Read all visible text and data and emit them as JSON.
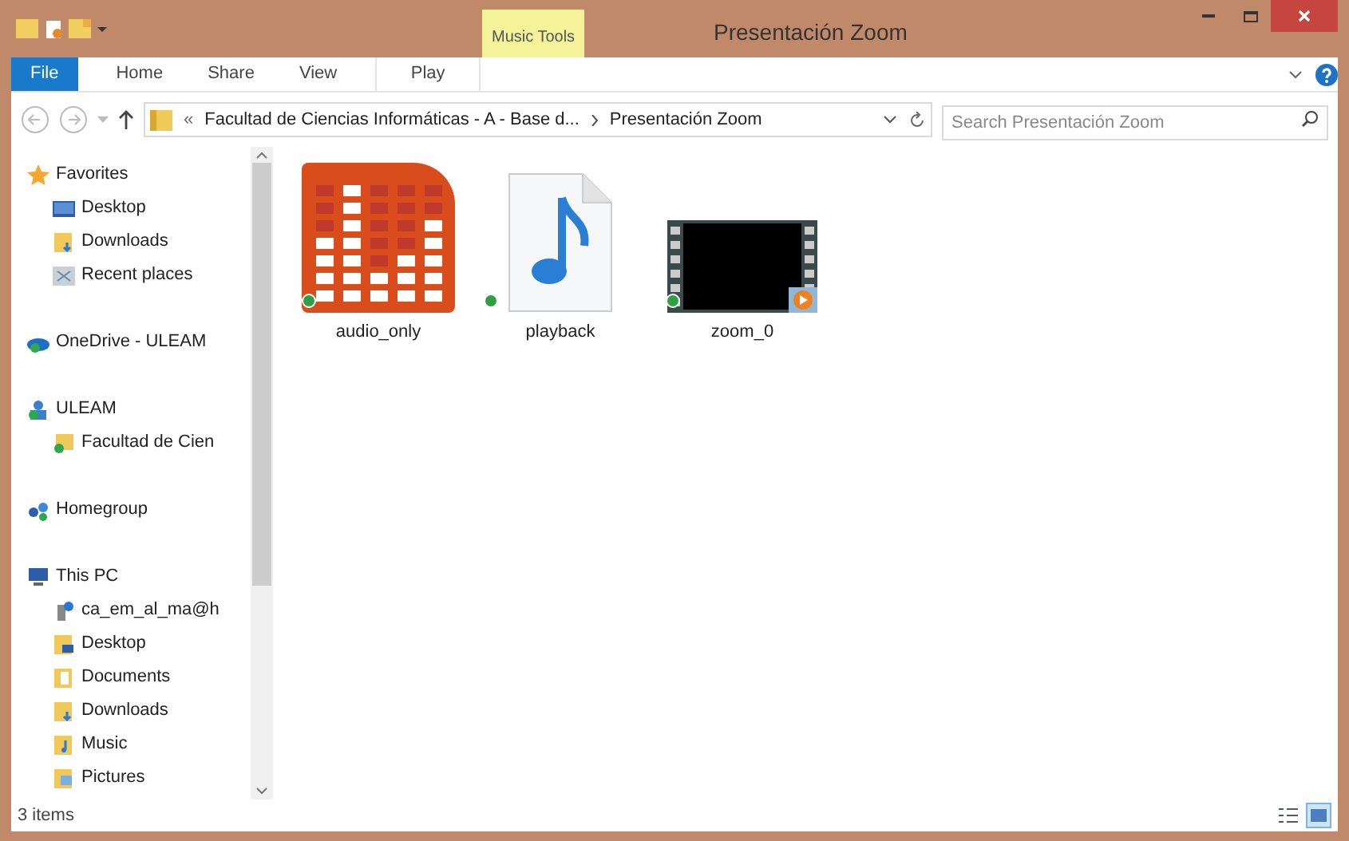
{
  "window": {
    "title": "Presentación Zoom",
    "context_group": "Music Tools"
  },
  "ribbon_tabs": [
    {
      "label": "File",
      "kind": "file",
      "selected": false
    },
    {
      "label": "Home",
      "kind": "tab",
      "selected": false
    },
    {
      "label": "Share",
      "kind": "tab",
      "selected": false
    },
    {
      "label": "View",
      "kind": "tab",
      "selected": false
    },
    {
      "label": "Play",
      "kind": "context",
      "selected": false
    }
  ],
  "address": {
    "overflow": "«",
    "segments": [
      "Facultad de Ciencias Informáticas - A - Base d...",
      "Presentación Zoom"
    ]
  },
  "search": {
    "placeholder": "Search Presentación Zoom"
  },
  "nav_tree": [
    {
      "label": "Favorites",
      "children": [
        {
          "label": "Desktop"
        },
        {
          "label": "Downloads"
        },
        {
          "label": "Recent places"
        }
      ]
    },
    {
      "label": "OneDrive - ULEAM"
    },
    {
      "label": "ULEAM",
      "children": [
        {
          "label": "Facultad de Cien"
        }
      ]
    },
    {
      "label": "Homegroup"
    },
    {
      "label": "This PC",
      "children": [
        {
          "label": "ca_em_al_ma@h"
        },
        {
          "label": "Desktop"
        },
        {
          "label": "Documents"
        },
        {
          "label": "Downloads"
        },
        {
          "label": "Music"
        },
        {
          "label": "Pictures"
        }
      ]
    }
  ],
  "files": [
    {
      "name": "audio_only",
      "kind": "equalizer",
      "synced": true
    },
    {
      "name": "playback",
      "kind": "music",
      "synced": true
    },
    {
      "name": "zoom_0",
      "kind": "video",
      "synced": true
    }
  ],
  "status_bar": {
    "count": "3 items"
  },
  "views": [
    {
      "kind": "details",
      "selected": false
    },
    {
      "kind": "large-icons",
      "selected": true
    }
  ]
}
